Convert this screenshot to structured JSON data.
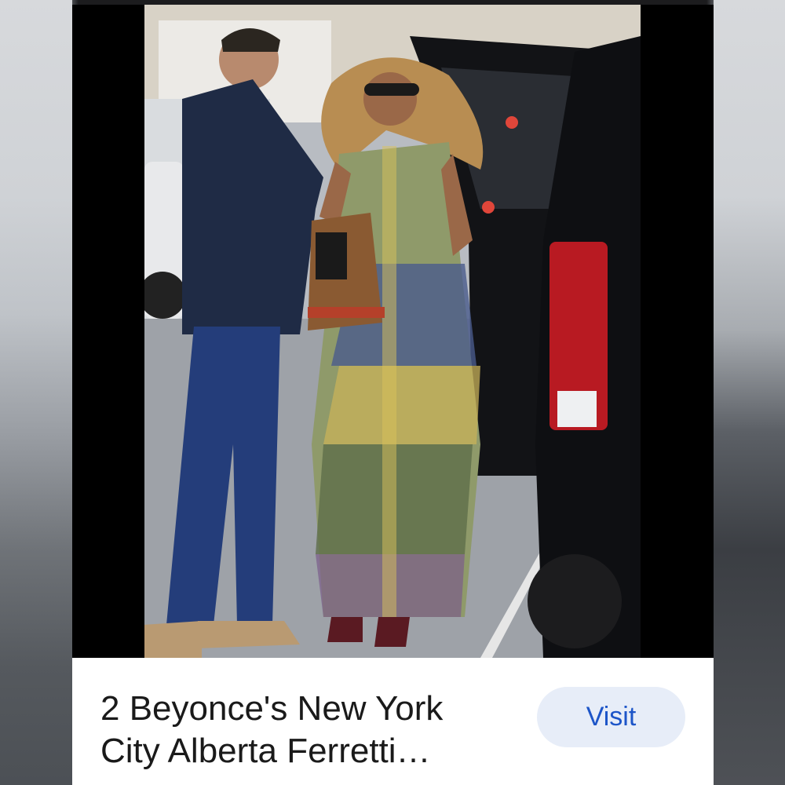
{
  "result": {
    "title_line1": "2 Beyonce's New York",
    "title_line2": "City Alberta Ferretti…",
    "visit_label": "Visit"
  },
  "colors": {
    "visit_text": "#1d55c8",
    "visit_bg": "#e7edf8",
    "caption_text": "#1a1a1a"
  }
}
